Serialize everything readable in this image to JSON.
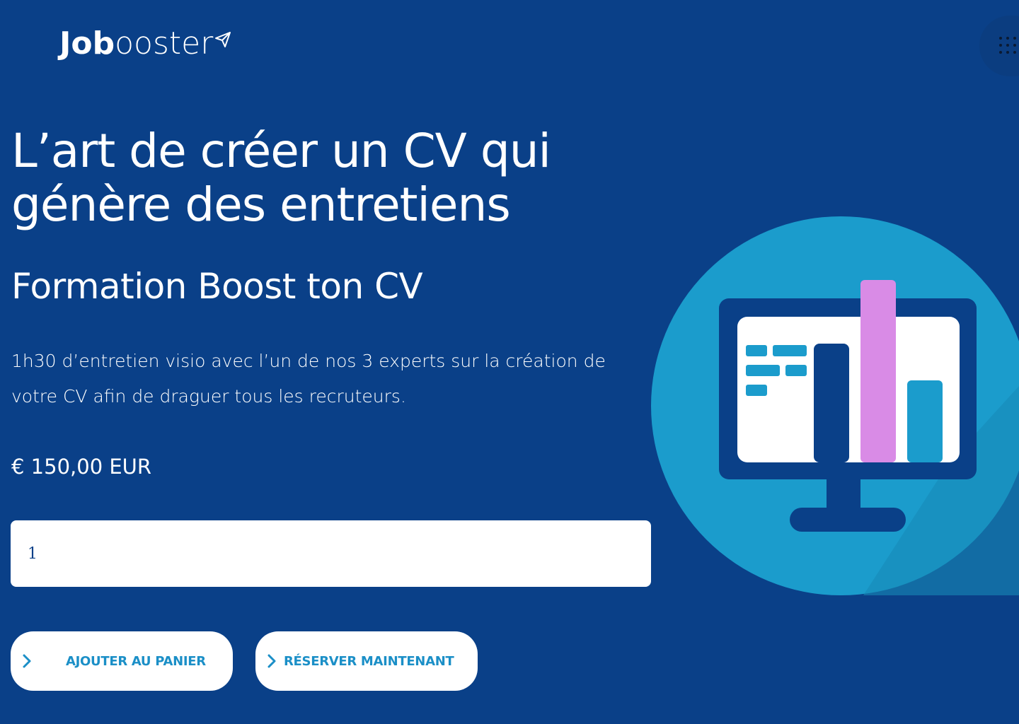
{
  "header": {
    "logo_bold": "Job",
    "logo_light": "ooster",
    "logo_icon": "paper-plane-icon",
    "menu_icon": "grid-menu-icon"
  },
  "hero": {
    "headline": "L’art de créer un CV qui génère des entretiens",
    "subtitle": "Formation Boost ton CV",
    "description": "1h30 d’entretien visio avec l’un de nos 3 experts sur la création de votre CV afin de draguer tous les recruteurs.",
    "price": "€ 150,00 EUR"
  },
  "quantity": {
    "value": "1"
  },
  "actions": {
    "add_to_cart_label": "AJOUTER AU PANIER",
    "book_now_label": "RÉSERVER MAINTENANT",
    "chevron_icon": "chevron-right-icon"
  },
  "illustration": {
    "icon": "monitor-chart-icon"
  },
  "colors": {
    "background": "#0a4088",
    "accent": "#1b8fc7",
    "circle": "#1b9ccc",
    "pink": "#d98be6"
  }
}
